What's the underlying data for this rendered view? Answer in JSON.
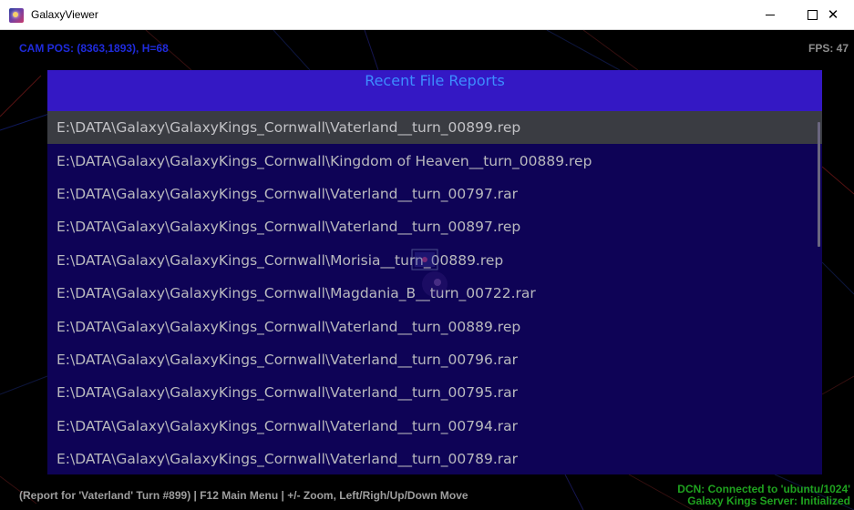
{
  "window": {
    "title": "GalaxyViewer",
    "minimize_icon": "minimize-icon",
    "maximize_icon": "maximize-icon",
    "close_icon": "close-icon"
  },
  "hud": {
    "cam_pos": "CAM POS: (8363,1893), H=68",
    "fps": "FPS: 47"
  },
  "panel": {
    "title": "Recent File Reports",
    "selected_index": 0,
    "files": [
      "E:\\DATA\\Galaxy\\GalaxyKings_Cornwall\\Vaterland__turn_00899.rep",
      "E:\\DATA\\Galaxy\\GalaxyKings_Cornwall\\Kingdom of Heaven__turn_00889.rep",
      "E:\\DATA\\Galaxy\\GalaxyKings_Cornwall\\Vaterland__turn_00797.rar",
      "E:\\DATA\\Galaxy\\GalaxyKings_Cornwall\\Vaterland__turn_00897.rep",
      "E:\\DATA\\Galaxy\\GalaxyKings_Cornwall\\Morisia__turn_00889.rep",
      "E:\\DATA\\Galaxy\\GalaxyKings_Cornwall\\Magdania_B__turn_00722.rar",
      "E:\\DATA\\Galaxy\\GalaxyKings_Cornwall\\Vaterland__turn_00889.rep",
      "E:\\DATA\\Galaxy\\GalaxyKings_Cornwall\\Vaterland__turn_00796.rar",
      "E:\\DATA\\Galaxy\\GalaxyKings_Cornwall\\Vaterland__turn_00795.rar",
      "E:\\DATA\\Galaxy\\GalaxyKings_Cornwall\\Vaterland__turn_00794.rar",
      "E:\\DATA\\Galaxy\\GalaxyKings_Cornwall\\Vaterland__turn_00789.rar"
    ]
  },
  "status": {
    "left": "(Report for 'Vaterland' Turn #899) | F12 Main Menu | +/- Zoom, Left/Righ/Up/Down Move",
    "connection": "DCN: Connected to 'ubuntu/1024'",
    "server": "Galaxy Kings Server: Initialized"
  },
  "colors": {
    "cam_pos": "#1f2bdc",
    "panel_header": "#3418c4",
    "panel_body": "#0e0356",
    "panel_title": "#3d8cff",
    "selected_row": "#3a3c42",
    "status_ok": "#1fa21f"
  }
}
